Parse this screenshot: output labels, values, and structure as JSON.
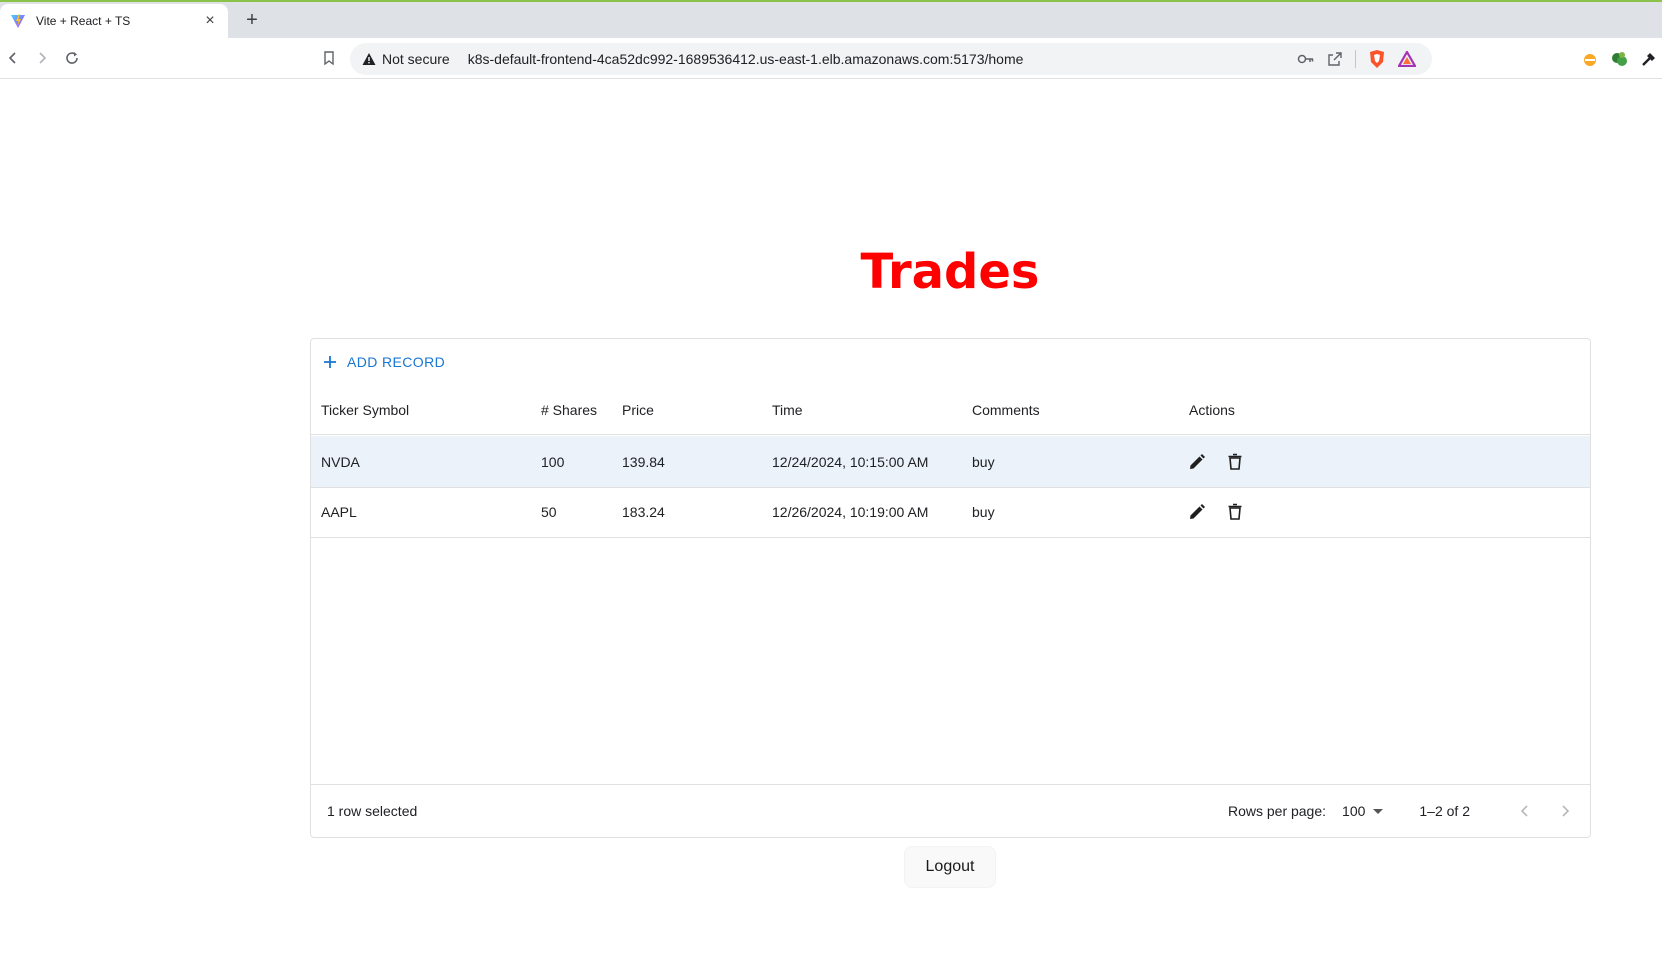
{
  "browser": {
    "tab_title": "Vite + React + TS",
    "tab_close": "×",
    "new_tab": "+",
    "security_label": "Not secure",
    "url": "k8s-default-frontend-4ca52dc992-1689536412.us-east-1.elb.amazonaws.com:5173/home"
  },
  "page": {
    "title": "Trades",
    "title_color": "#ff0000"
  },
  "grid": {
    "add_record_label": "ADD RECORD",
    "columns": {
      "ticker": "Ticker Symbol",
      "shares": "# Shares",
      "price": "Price",
      "time": "Time",
      "comments": "Comments",
      "actions": "Actions"
    },
    "rows": [
      {
        "ticker": "NVDA",
        "shares": "100",
        "price": "139.84",
        "time": "12/24/2024, 10:15:00 AM",
        "comments": "buy",
        "selected": true
      },
      {
        "ticker": "AAPL",
        "shares": "50",
        "price": "183.24",
        "time": "12/26/2024, 10:19:00 AM",
        "comments": "buy",
        "selected": false
      }
    ],
    "footer": {
      "selected_text": "1 row selected",
      "rows_per_page_label": "Rows per page:",
      "rows_per_page_value": "100",
      "range_text": "1–2 of 2"
    },
    "accent_color": "#1976d2",
    "selected_row_color": "#ebf2fa"
  },
  "logout_label": "Logout",
  "icons": [
    "vite-logo-icon",
    "back-icon",
    "forward-icon",
    "reload-icon",
    "bookmark-icon",
    "warning-icon",
    "key-icon",
    "share-icon",
    "brave-shield-icon",
    "brave-rewards-icon",
    "extension-orange-icon",
    "extension-green-icon",
    "eyedropper-icon",
    "plus-icon",
    "edit-icon",
    "delete-icon",
    "chevron-left-icon",
    "chevron-right-icon",
    "caret-down-icon"
  ]
}
